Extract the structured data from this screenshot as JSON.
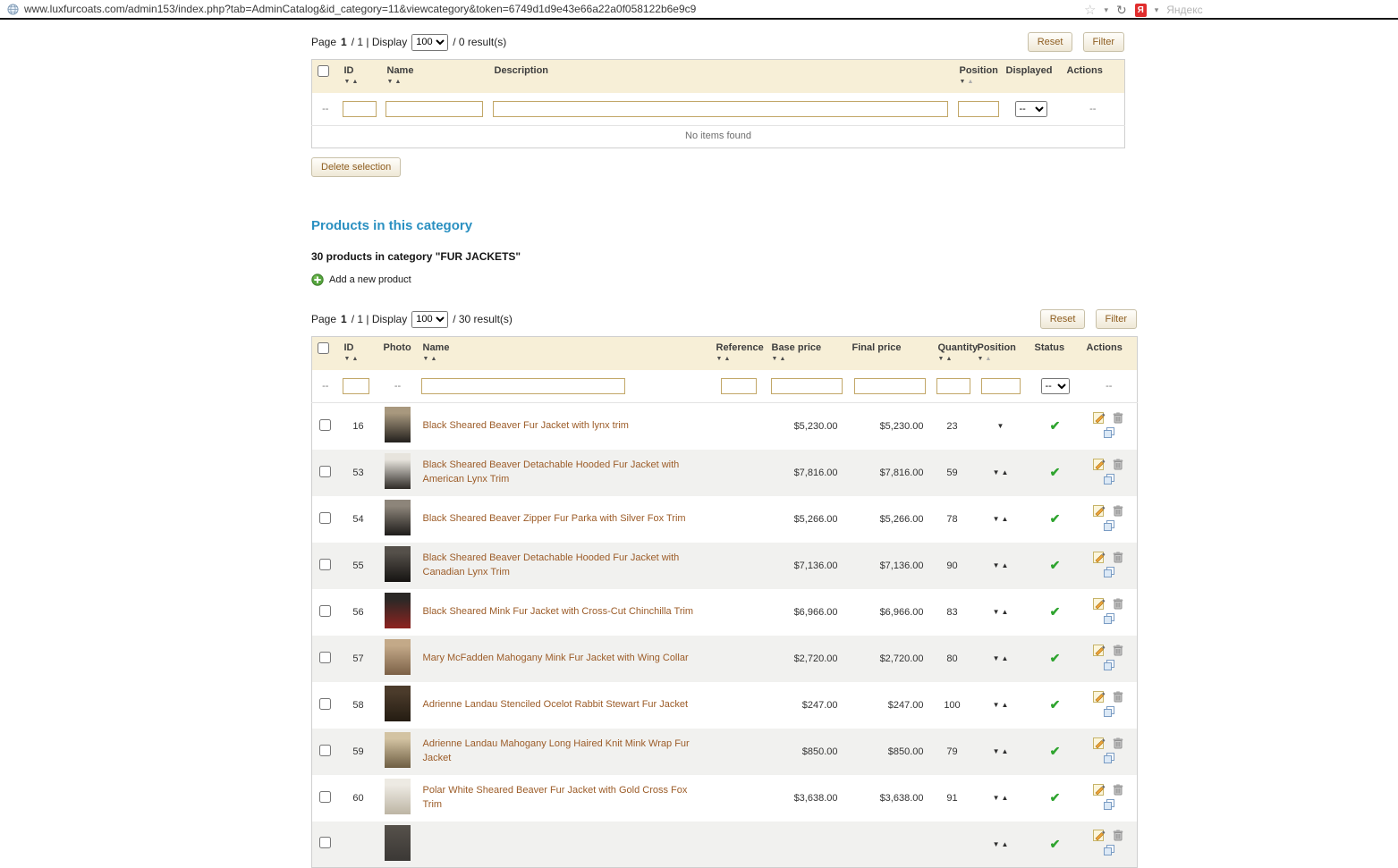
{
  "browser": {
    "url": "www.luxfurcoats.com/admin153/index.php?tab=AdminCatalog&id_category=11&viewcategory&token=6749d1d9e43e66a22a0f058122b6e9c9",
    "yandex_label": "Яндекс"
  },
  "icons": {
    "star": "☆",
    "caret_down": "▾",
    "refresh": "↻",
    "yandex_letter": "Я",
    "sort_down": "▼",
    "sort_up": "▲",
    "check": "✔"
  },
  "filter_dash": "--",
  "subcategories": {
    "pagination": {
      "page_label": "Page",
      "page_number": "1",
      "page_of": "/ 1 | Display",
      "display_value": "100",
      "results_text": "/ 0 result(s)"
    },
    "reset_button": "Reset",
    "filter_button": "Filter",
    "columns": {
      "id": "ID",
      "name": "Name",
      "description": "Description",
      "position": "Position",
      "displayed": "Displayed",
      "actions": "Actions"
    },
    "filter_displayed_value": "--",
    "empty_message": "No items found",
    "delete_selection_button": "Delete selection"
  },
  "products": {
    "heading": "Products in this category",
    "count_text": "30 products in category \"FUR JACKETS\"",
    "add_product_label": "Add a new product",
    "pagination": {
      "page_label": "Page",
      "page_number": "1",
      "page_of": "/ 1 | Display",
      "display_value": "100",
      "results_text": "/ 30 result(s)"
    },
    "reset_button": "Reset",
    "filter_button": "Filter",
    "columns": {
      "id": "ID",
      "photo": "Photo",
      "name": "Name",
      "reference": "Reference",
      "base_price": "Base price",
      "final_price": "Final price",
      "quantity": "Quantity",
      "position": "Position",
      "status": "Status",
      "actions": "Actions"
    },
    "filter_status_value": "--",
    "rows": [
      {
        "id": "16",
        "name": "Black Sheared Beaver Fur Jacket with lynx trim",
        "base_price": "$5,230.00",
        "final_price": "$5,230.00",
        "quantity": "23",
        "position_arrows": "down",
        "thumb": [
          "#A8987E",
          "#23201D"
        ]
      },
      {
        "id": "53",
        "name": "Black Sheared Beaver Detachable Hooded Fur Jacket with American Lynx Trim",
        "base_price": "$7,816.00",
        "final_price": "$7,816.00",
        "quantity": "59",
        "position_arrows": "both",
        "thumb": [
          "#E7E4DD",
          "#2E2A26"
        ]
      },
      {
        "id": "54",
        "name": "Black Sheared Beaver Zipper Fur Parka with Silver Fox Trim",
        "base_price": "$5,266.00",
        "final_price": "$5,266.00",
        "quantity": "78",
        "position_arrows": "both",
        "thumb": [
          "#8D857A",
          "#1E1C1A"
        ]
      },
      {
        "id": "55",
        "name": "Black Sheared Beaver Detachable Hooded Fur Jacket with Canadian Lynx Trim",
        "base_price": "$7,136.00",
        "final_price": "$7,136.00",
        "quantity": "90",
        "position_arrows": "both",
        "thumb": [
          "#55504A",
          "#161412"
        ]
      },
      {
        "id": "56",
        "name": "Black Sheared Mink Fur Jacket with Cross-Cut Chinchilla Trim",
        "base_price": "$6,966.00",
        "final_price": "$6,966.00",
        "quantity": "83",
        "position_arrows": "both",
        "thumb": [
          "#2B2826",
          "#8E2320"
        ]
      },
      {
        "id": "57",
        "name": "Mary McFadden Mahogany Mink Fur Jacket with Wing Collar",
        "base_price": "$2,720.00",
        "final_price": "$2,720.00",
        "quantity": "80",
        "position_arrows": "both",
        "thumb": [
          "#C3A988",
          "#7C6147"
        ]
      },
      {
        "id": "58",
        "name": "Adrienne Landau Stenciled Ocelot Rabbit Stewart Fur Jacket",
        "base_price": "$247.00",
        "final_price": "$247.00",
        "quantity": "100",
        "position_arrows": "both",
        "thumb": [
          "#4B3B2B",
          "#241C12"
        ]
      },
      {
        "id": "59",
        "name": "Adrienne Landau Mahogany Long Haired Knit Mink Wrap Fur Jacket",
        "base_price": "$850.00",
        "final_price": "$850.00",
        "quantity": "79",
        "position_arrows": "both",
        "thumb": [
          "#D3C3A2",
          "#6E5E43"
        ]
      },
      {
        "id": "60",
        "name": "Polar White Sheared Beaver Fur Jacket with Gold Cross Fox Trim",
        "base_price": "$3,638.00",
        "final_price": "$3,638.00",
        "quantity": "91",
        "position_arrows": "both",
        "thumb": [
          "#EDEAE3",
          "#BDB5A4"
        ]
      }
    ],
    "partial_row": {
      "thumb": [
        "#56514B",
        "#3B3835"
      ]
    }
  }
}
